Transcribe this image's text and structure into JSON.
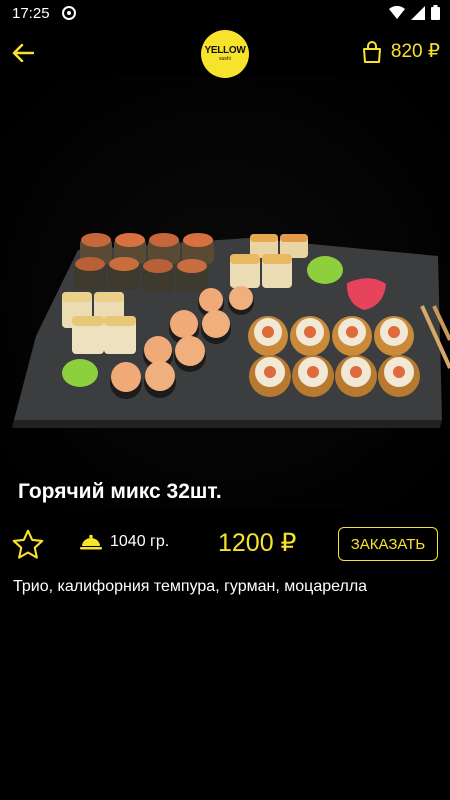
{
  "status_bar": {
    "time": "17:25",
    "icons": [
      "app-notification-icon",
      "wifi-icon",
      "signal-icon",
      "battery-icon"
    ]
  },
  "header": {
    "back_icon": "arrow-left-icon",
    "logo_text": "YELLOW",
    "logo_subtext": "sushi",
    "cart_icon": "shopping-bag-icon",
    "cart_amount": "820 ₽"
  },
  "product": {
    "title": "Горячий микс 32шт.",
    "weight": "1040 гр.",
    "weight_icon": "cloche-icon",
    "price": "1200 ₽",
    "order_label": "ЗАКАЗАТЬ",
    "favorite_icon": "star-outline-icon",
    "description": "Трио, калифорния темпура, гурман, моцарелла"
  },
  "colors": {
    "accent": "#f7e22c",
    "background": "#000000",
    "text": "#ffffff"
  }
}
